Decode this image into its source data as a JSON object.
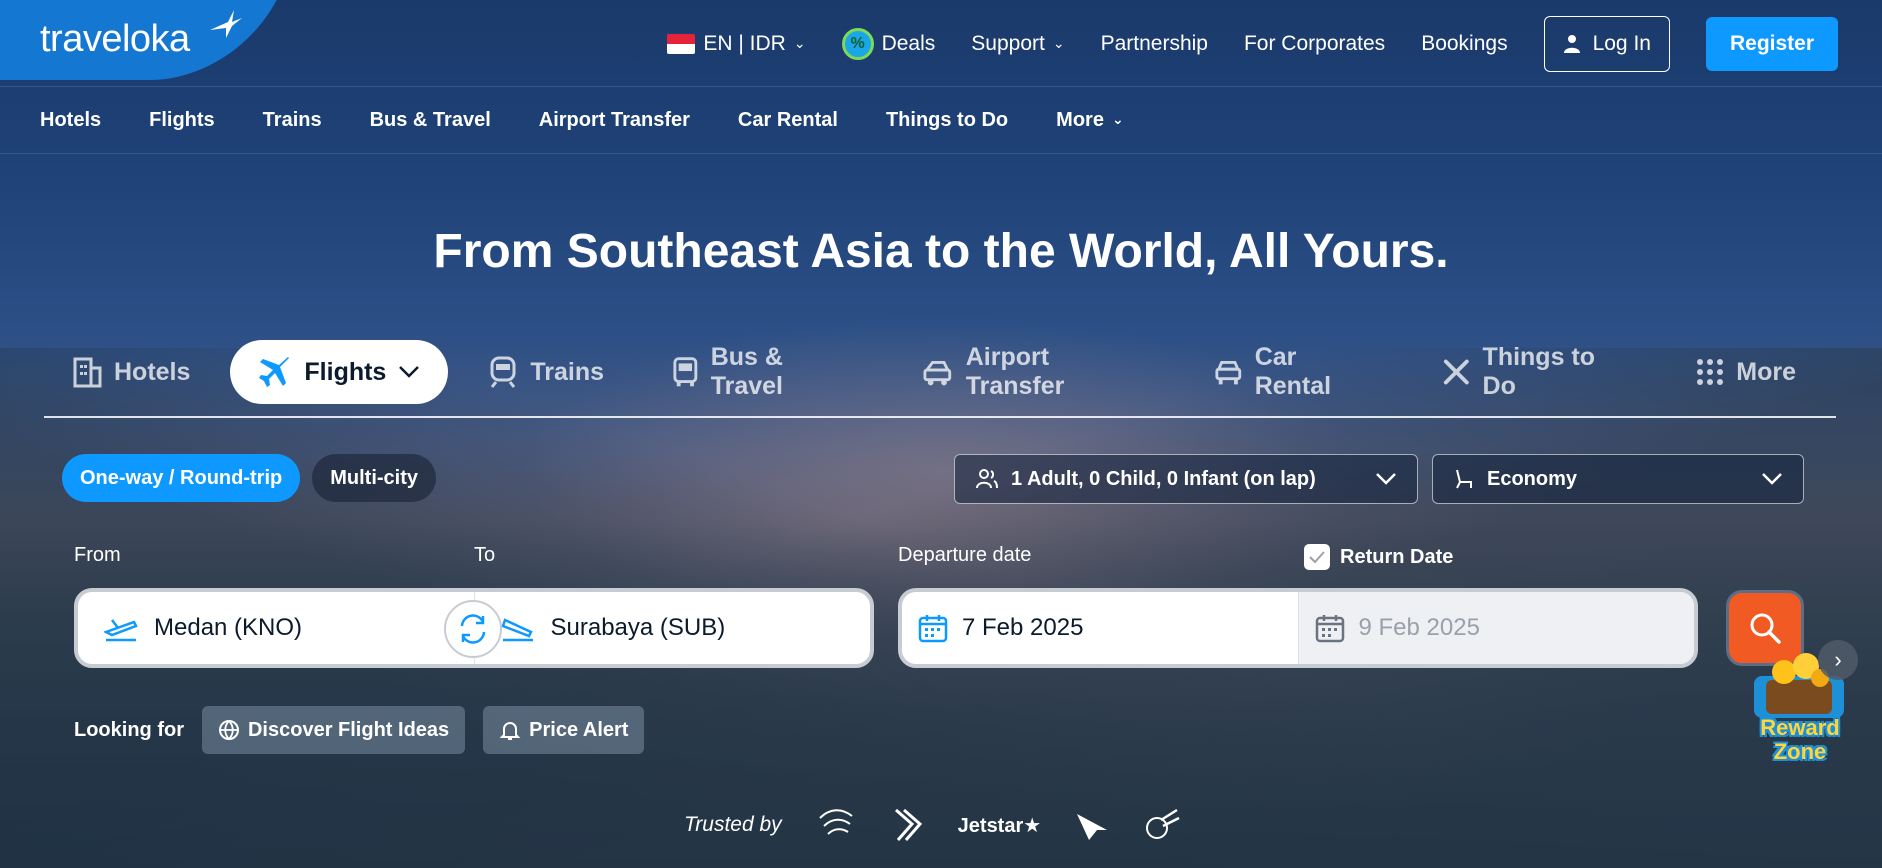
{
  "brand": {
    "name": "traveloka"
  },
  "topbar": {
    "language": "EN | IDR",
    "deals": "Deals",
    "support": "Support",
    "partnership": "Partnership",
    "corporates": "For Corporates",
    "bookings": "Bookings",
    "login": "Log In",
    "register": "Register"
  },
  "nav": {
    "items": [
      "Hotels",
      "Flights",
      "Trains",
      "Bus & Travel",
      "Airport Transfer",
      "Car Rental",
      "Things to Do",
      "More"
    ]
  },
  "hero": {
    "headline": "From Southeast Asia to the World, All Yours."
  },
  "product_tabs": [
    "Hotels",
    "Flights",
    "Trains",
    "Bus & Travel",
    "Airport Transfer",
    "Car Rental",
    "Things to Do",
    "More"
  ],
  "product_tabs_active": "Flights",
  "trip_type": {
    "one_way": "One-way / Round-trip",
    "multi_city": "Multi-city",
    "selected": "One-way / Round-trip"
  },
  "passengers": "1 Adult, 0 Child, 0 Infant (on lap)",
  "seat_class": "Economy",
  "form": {
    "from_label": "From",
    "to_label": "To",
    "departure_label": "Departure date",
    "return_label": "Return Date",
    "return_checked": true,
    "from_value": "Medan (KNO)",
    "to_value": "Surabaya (SUB)",
    "departure_value": "7 Feb 2025",
    "return_value": "9 Feb 2025"
  },
  "looking_for": {
    "label": "Looking for",
    "discover": "Discover Flight Ideas",
    "price_alert": "Price Alert"
  },
  "reward": {
    "line1": "Reward",
    "line2": "Zone"
  },
  "trusted": {
    "label": "Trusted by",
    "jetstar": "Jetstar"
  },
  "colors": {
    "primary": "#0d99ff",
    "search": "#f15a22",
    "brand_blob": "#1478d2"
  }
}
